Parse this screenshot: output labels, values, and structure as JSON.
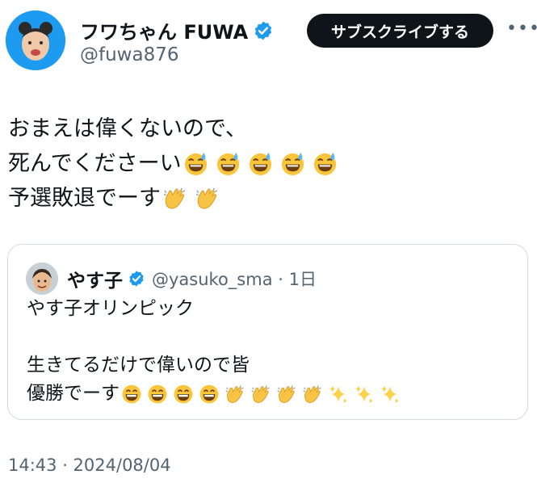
{
  "author": {
    "display_name": "フワちゃん FUWA",
    "handle": "@fuwa876",
    "avatar": "avatar-image"
  },
  "actions": {
    "subscribe_label": "サブスクライブする",
    "more_icon": "more-icon"
  },
  "tweet": {
    "line1": "おまえは偉くないので、",
    "line2_text": "死んでくださーい",
    "line2_emojis": [
      "grinning-sweat-emoji",
      "grinning-sweat-emoji",
      "grinning-sweat-emoji",
      "grinning-sweat-emoji",
      "grinning-sweat-emoji"
    ],
    "line3_text": "予選敗退でーす",
    "line3_emojis": [
      "clapping-hands-emoji",
      "clapping-hands-emoji"
    ]
  },
  "quote": {
    "display_name": "やす子",
    "handle_time": "@yasuko_sma · 1日",
    "line1": "やす子オリンピック",
    "line2": "",
    "line3": "生きてるだけで偉いので皆",
    "line4_text": "優勝でーす",
    "line4_emojis": [
      "grinning-emoji",
      "grinning-emoji",
      "grinning-emoji",
      "grinning-emoji",
      "clapping-hands-emoji",
      "clapping-hands-emoji",
      "clapping-hands-emoji",
      "clapping-hands-emoji",
      "sparkles-emoji",
      "sparkles-emoji",
      "sparkles-emoji"
    ]
  },
  "timestamp": "14:43 · 2024/08/04",
  "colors": {
    "verified": "#1d9bf0",
    "button_bg": "#0f1419",
    "secondary_text": "#536471",
    "border": "#d5dade"
  }
}
